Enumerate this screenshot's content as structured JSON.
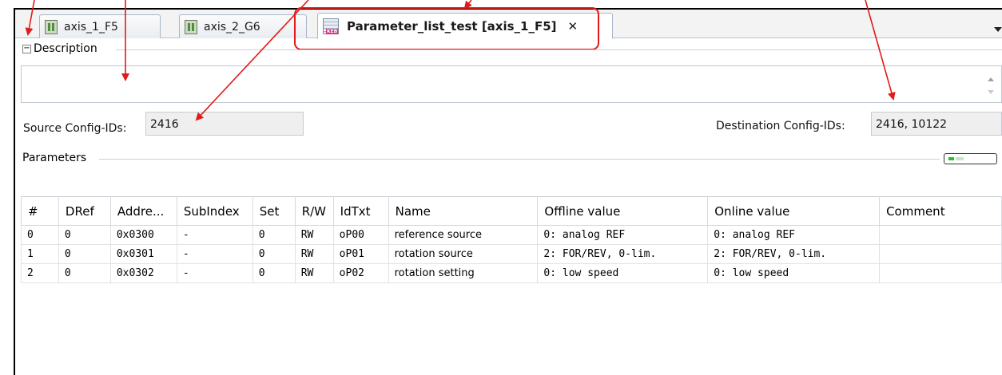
{
  "tabs": [
    {
      "label": "axis_1_F5",
      "icon": "device-icon"
    },
    {
      "label": "axis_2_G6",
      "icon": "device-icon"
    }
  ],
  "active_tab": {
    "label": "Parameter_list_test [axis_1_F5]",
    "icon": "keb-parameter-list-icon",
    "close": "✕"
  },
  "icon_badge": "KEB",
  "description": {
    "header": "Description",
    "collapse": "−",
    "text": ""
  },
  "source": {
    "label": "Source Config-IDs:",
    "value": "2416"
  },
  "destination": {
    "label": "Destination Config-IDs:",
    "value": "2416, 10122"
  },
  "parameters": {
    "header": "Parameters",
    "columns": [
      "#",
      "DRef",
      "Addre...",
      "SubIndex",
      "Set",
      "R/W",
      "IdTxt",
      "Name",
      "Offline value",
      "Online value",
      "Comment"
    ],
    "rows": [
      [
        "0",
        "0",
        "0x0300",
        "-",
        "0",
        "RW",
        "oP00",
        "reference source",
        "0: analog REF",
        "0: analog REF",
        ""
      ],
      [
        "1",
        "0",
        "0x0301",
        "-",
        "0",
        "RW",
        "oP01",
        "rotation source",
        "2: FOR/REV, 0-lim.",
        "2: FOR/REV, 0-lim.",
        ""
      ],
      [
        "2",
        "0",
        "0x0302",
        "-",
        "0",
        "RW",
        "oP02",
        "rotation setting",
        "0: low speed",
        "0: low speed",
        ""
      ]
    ]
  },
  "colors": {
    "annotation": "#e21a1a",
    "accent_green": "#2bbf2b"
  }
}
